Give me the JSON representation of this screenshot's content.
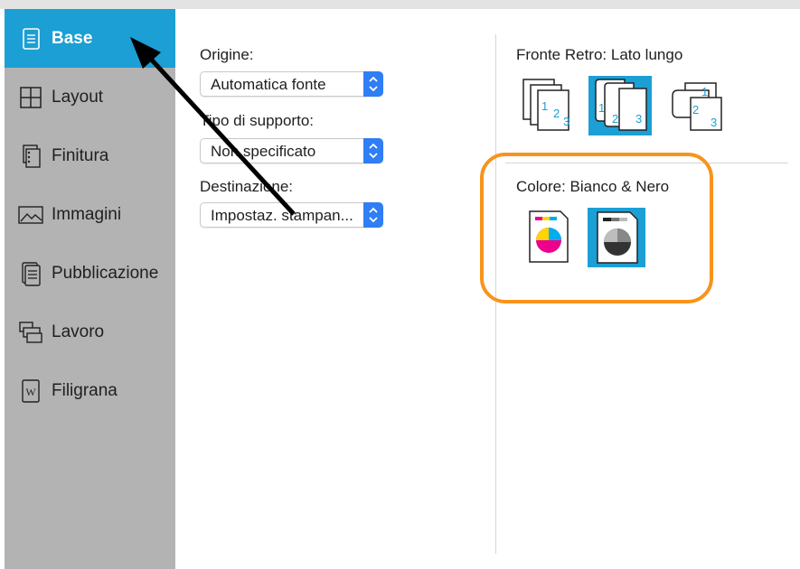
{
  "sidebar": {
    "items": [
      {
        "label": "Base",
        "icon": "document-icon",
        "active": true
      },
      {
        "label": "Layout",
        "icon": "layout-grid-icon",
        "active": false
      },
      {
        "label": "Finitura",
        "icon": "finishing-icon",
        "active": false
      },
      {
        "label": "Immagini",
        "icon": "image-icon",
        "active": false
      },
      {
        "label": "Pubblicazione",
        "icon": "publication-icon",
        "active": false
      },
      {
        "label": "Lavoro",
        "icon": "job-icon",
        "active": false
      },
      {
        "label": "Filigrana",
        "icon": "watermark-icon",
        "active": false
      }
    ]
  },
  "main": {
    "origine": {
      "label": "Origine:",
      "value": "Automatica fonte"
    },
    "tipo_supporto": {
      "label": "Tipo di supporto:",
      "value": "Non specificato"
    },
    "destinazione": {
      "label": "Destinazione:",
      "value": "Impostaz. stampan..."
    }
  },
  "duplex": {
    "title": "Fronte Retro: Lato lungo",
    "options": [
      "simplex-icon",
      "duplex-long-edge-icon",
      "duplex-short-edge-icon"
    ],
    "selected_index": 1
  },
  "color": {
    "title": "Colore: Bianco & Nero",
    "options": [
      "color-print-icon",
      "black-white-print-icon"
    ],
    "selected_index": 1
  },
  "colors": {
    "accent": "#1b9fd4",
    "sidebar_bg": "#b3b3b3",
    "highlight": "#f7941d",
    "stepper": "#2f7ef5"
  }
}
